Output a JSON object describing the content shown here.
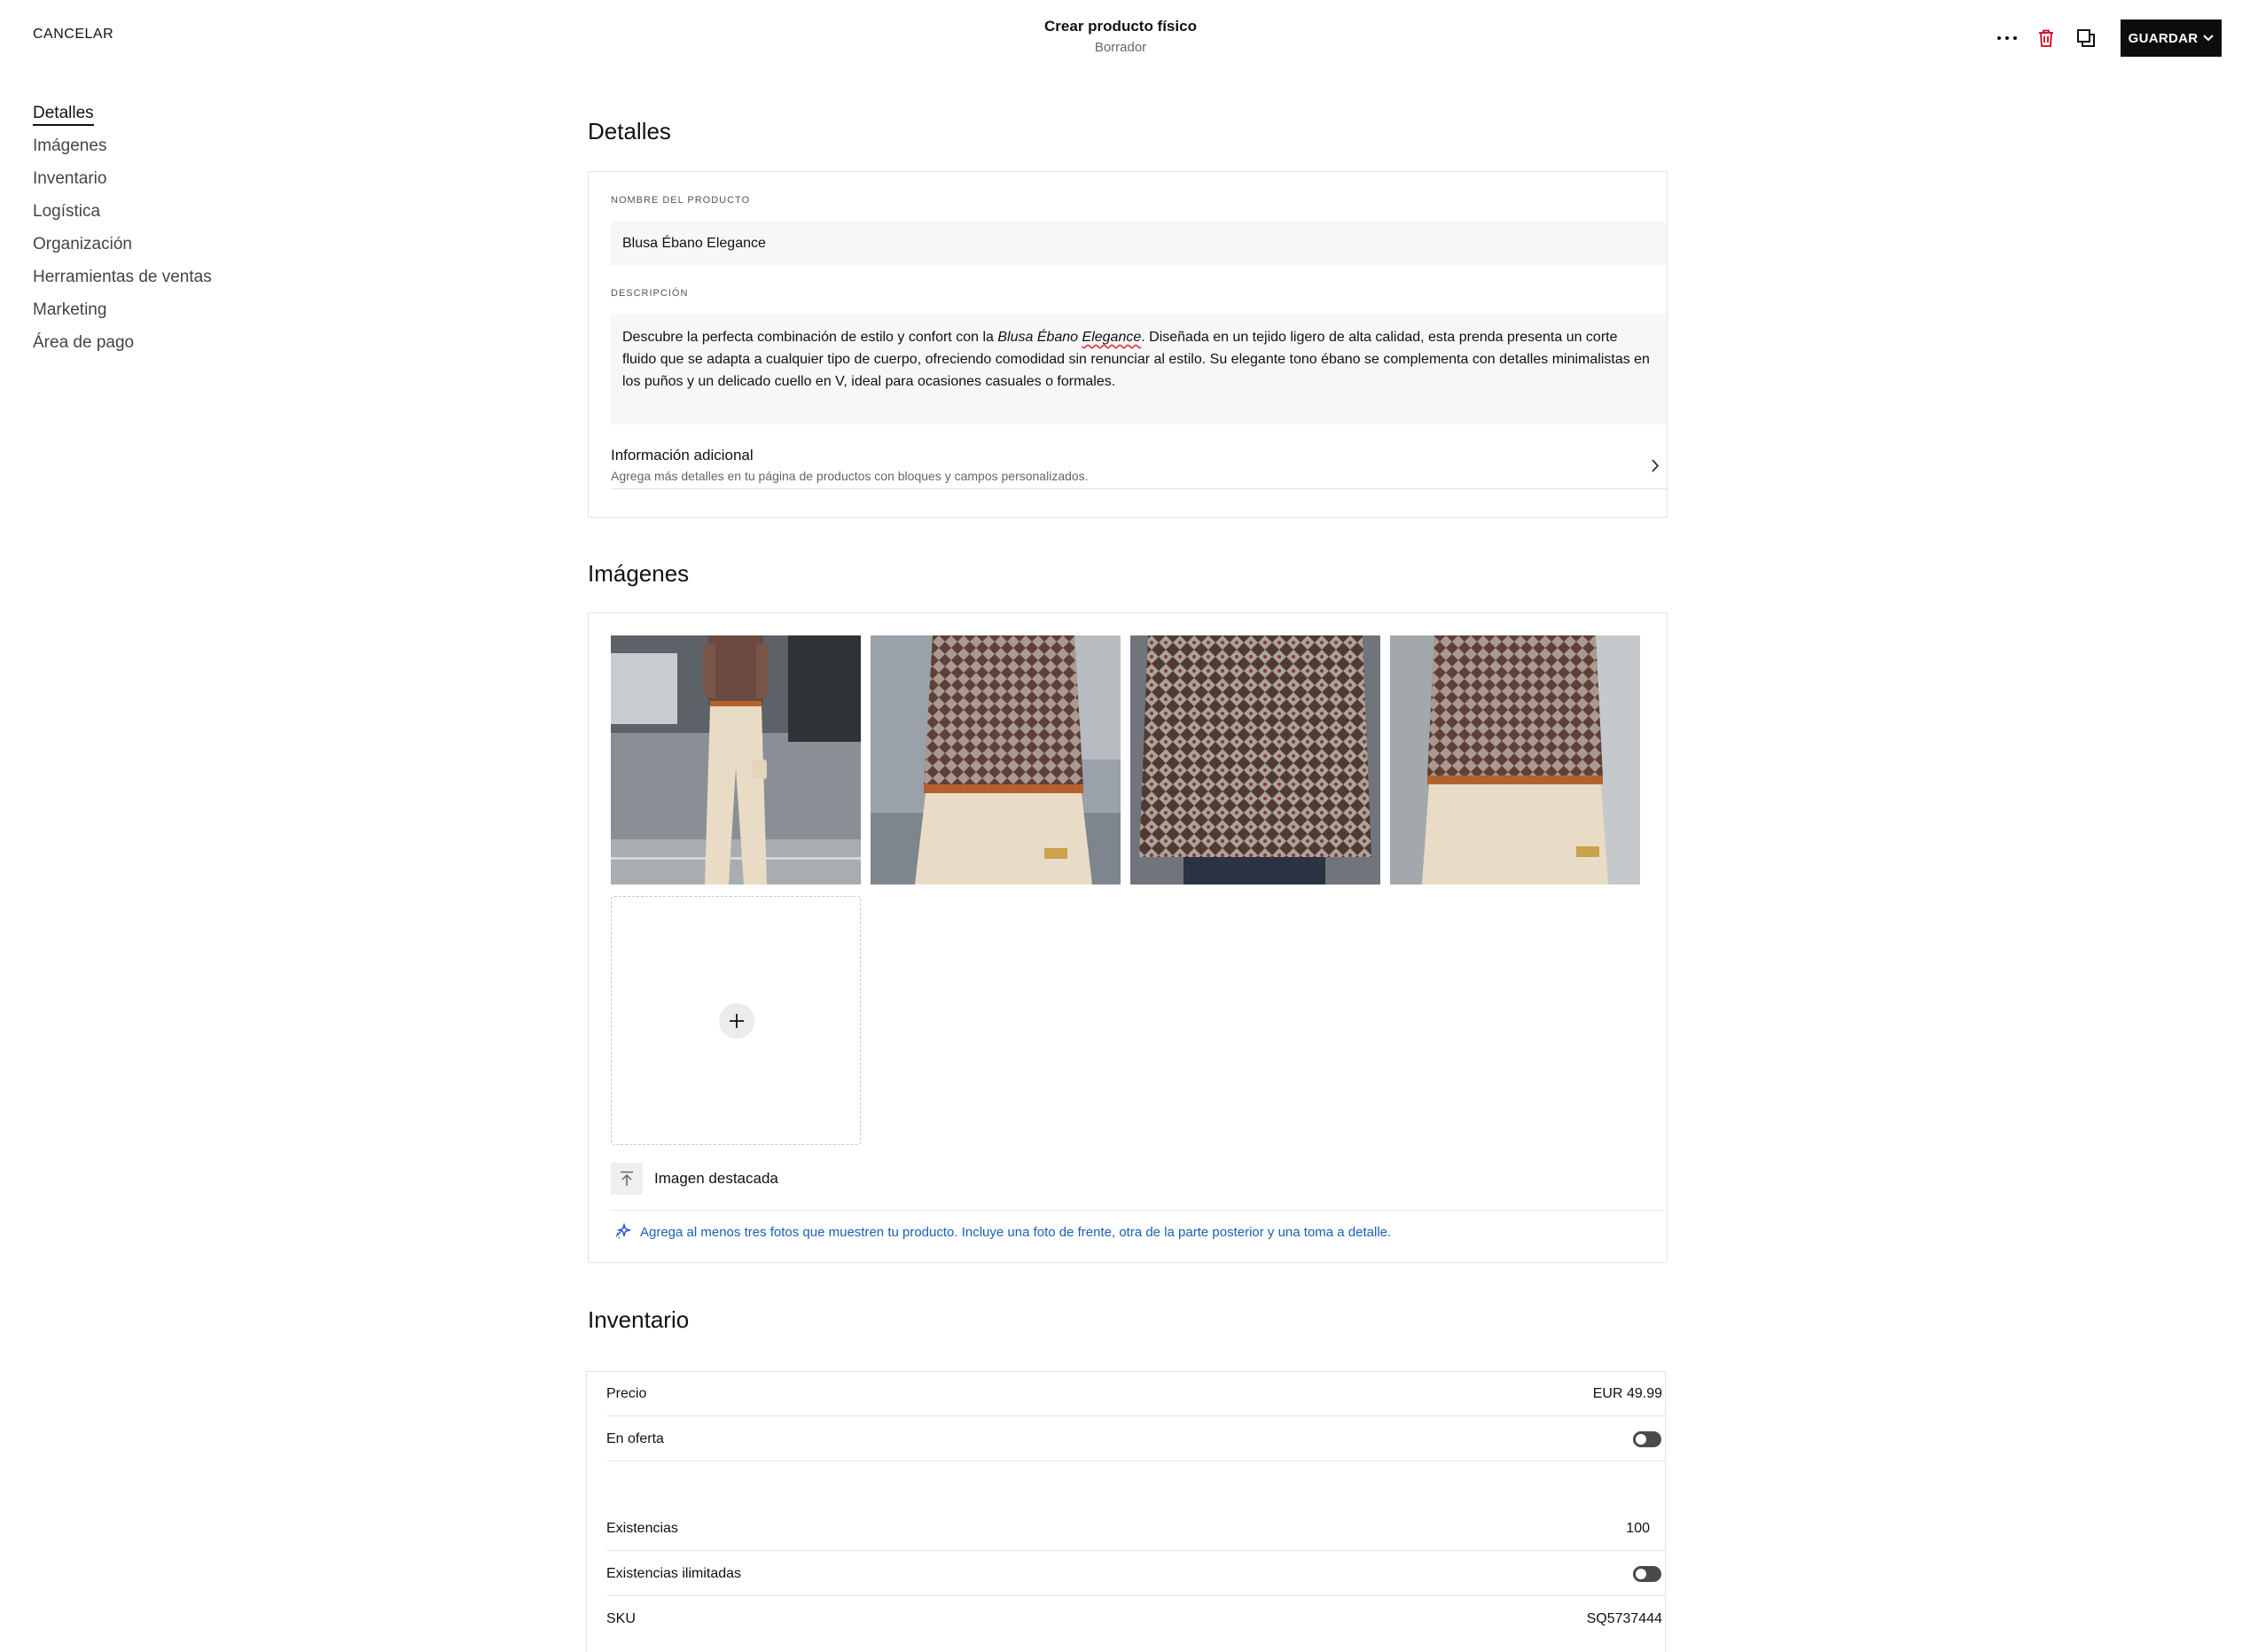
{
  "header": {
    "cancel_label": "CANCELAR",
    "title": "Crear producto físico",
    "status": "Borrador",
    "save_label": "GUARDAR",
    "icons": [
      "more-icon",
      "trash-icon",
      "preview-icon",
      "chevron-down-icon"
    ],
    "trash_color": "#d0021b"
  },
  "sidebar": {
    "items": [
      {
        "label": "Detalles",
        "active": true
      },
      {
        "label": "Imágenes"
      },
      {
        "label": "Inventario"
      },
      {
        "label": "Logística"
      },
      {
        "label": "Organización"
      },
      {
        "label": "Herramientas de ventas"
      },
      {
        "label": "Marketing"
      },
      {
        "label": "Área de pago"
      }
    ]
  },
  "details": {
    "heading": "Detalles",
    "name_label": "NOMBRE DEL PRODUCTO",
    "name_value": "Blusa Ébano Elegance",
    "description_label": "DESCRIPCIÓN",
    "description_before": "Descubre la perfecta combinación de estilo y confort con la ",
    "description_em_1": "Blusa Ébano ",
    "description_em_2": "Elegance",
    "description_after": ". Diseñada en un tejido ligero de alta calidad, esta prenda presenta un corte fluido que se adapta a cualquier tipo de cuerpo, ofreciendo comodidad sin renunciar al estilo. Su elegante tono ébano se complementa con detalles minimalistas en los puños y un delicado cuello en V, ideal para ocasiones casuales o formales.",
    "additional_title": "Información adicional",
    "additional_subtitle": "Agrega más detalles en tu página de productos con bloques y campos personalizados."
  },
  "images": {
    "heading": "Imágenes",
    "featured_label": "Imagen destacada",
    "tip": "Agrega al menos tres fotos que muestren tu producto. Incluye una foto de frente, otra de la parte posterior y una toma a detalle.",
    "tip_color": "#1a5fb4"
  },
  "inventory": {
    "heading": "Inventario",
    "price_label": "Precio",
    "price_value": "EUR 49.99",
    "sale_label": "En oferta",
    "sale_on": false,
    "stock_label": "Existencias",
    "stock_value": "100",
    "unlimited_label": "Existencias ilimitadas",
    "unlimited_on": false,
    "sku_label": "SKU",
    "sku_value": "SQ5737444"
  }
}
